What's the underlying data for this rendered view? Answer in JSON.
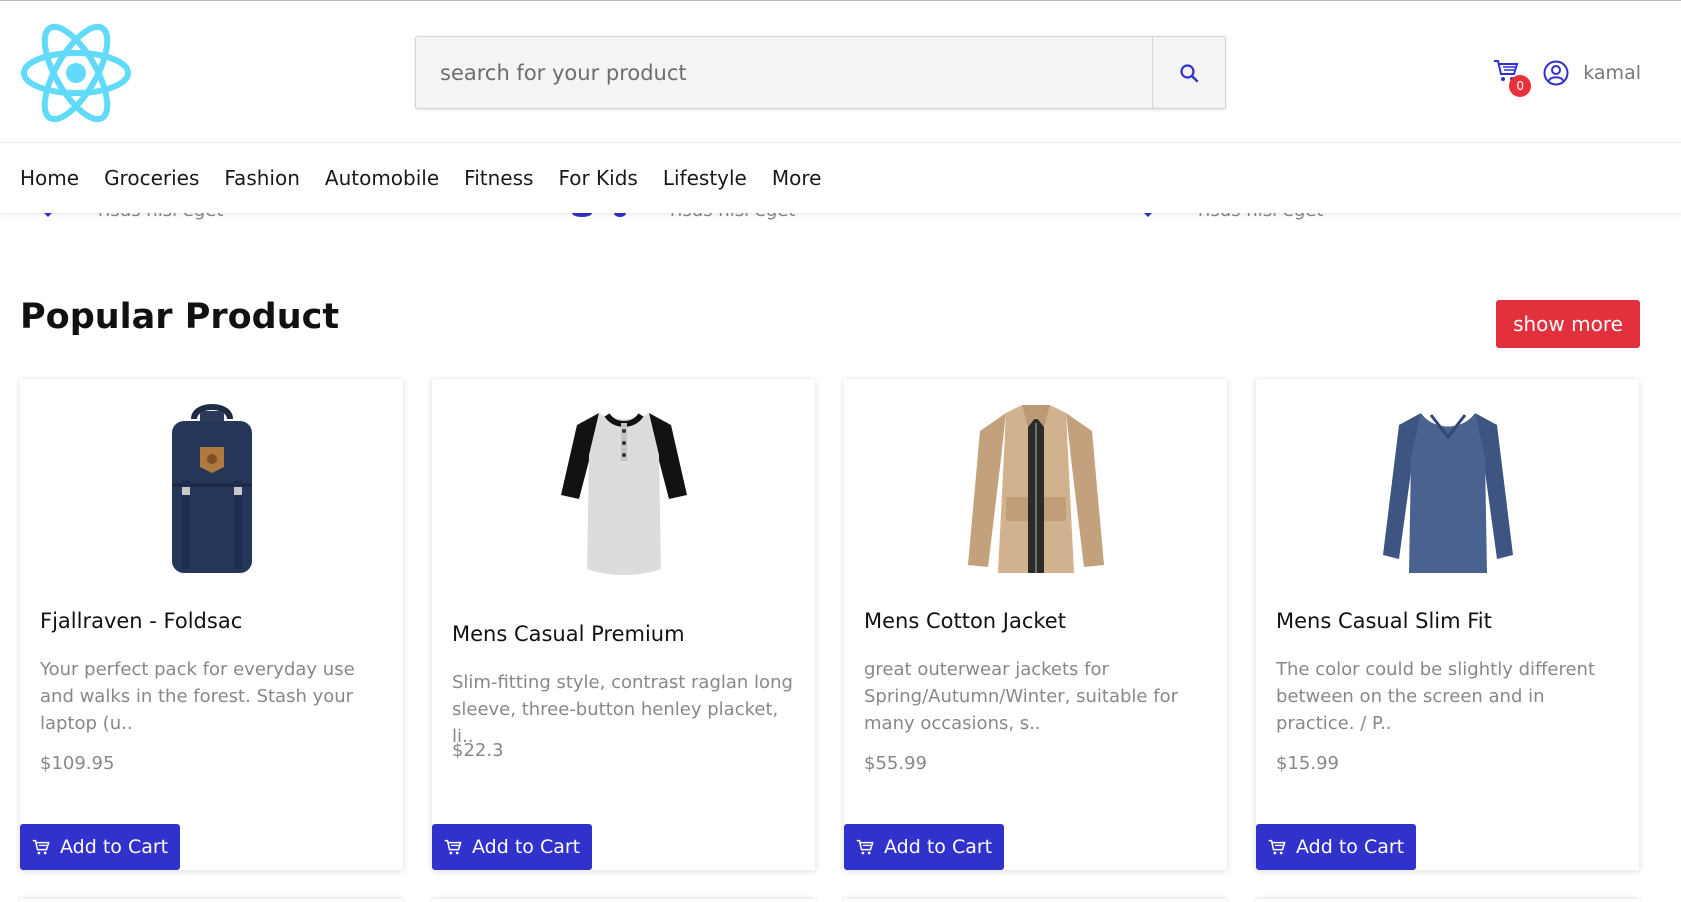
{
  "header": {
    "search": {
      "placeholder": "search for your product",
      "value": ""
    },
    "cart": {
      "count": "0"
    },
    "user": {
      "name": "kamal"
    }
  },
  "nav": {
    "items": [
      "Home",
      "Groceries",
      "Fashion",
      "Automobile",
      "Fitness",
      "For Kids",
      "Lifestyle",
      "More"
    ]
  },
  "features_peek": {
    "texts": [
      "risus nisi eget",
      "risus nisi eget",
      "risus nisi eget"
    ]
  },
  "section": {
    "title": "Popular Product",
    "show_more_label": "show more"
  },
  "products": [
    {
      "title": "Fjallraven - Foldsac",
      "description": "Your perfect pack for everyday use and walks in the forest. Stash your laptop (u..",
      "price": "$109.95",
      "add_label": "Add to Cart"
    },
    {
      "title": "Mens Casual Premium",
      "description": "Slim-fitting style, contrast raglan long sleeve, three-button henley placket, li..",
      "price": "$22.3",
      "add_label": "Add to Cart"
    },
    {
      "title": "Mens Cotton Jacket",
      "description": "great outerwear jackets for Spring/Autumn/Winter, suitable for many occasions, s..",
      "price": "$55.99",
      "add_label": "Add to Cart"
    },
    {
      "title": "Mens Casual Slim Fit",
      "description": "The color could be slightly different between on the screen and in practice. / P..",
      "price": "$15.99",
      "add_label": "Add to Cart"
    }
  ],
  "colors": {
    "accent_blue": "#3131cc",
    "accent_red": "#e2303d",
    "logo_cyan": "#61dafb"
  }
}
